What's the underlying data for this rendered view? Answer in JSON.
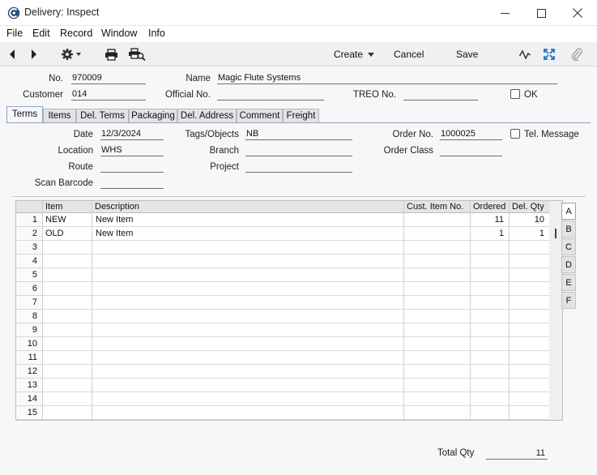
{
  "window": {
    "title": "Delivery: Inspect"
  },
  "menu": [
    "File",
    "Edit",
    "Record",
    "Window",
    "Info"
  ],
  "toolbar": {
    "create": "Create",
    "cancel": "Cancel",
    "save": "Save"
  },
  "header": {
    "no_label": "No.",
    "no": "970009",
    "name_label": "Name",
    "name": "Magic Flute Systems",
    "customer_label": "Customer",
    "customer": "014",
    "official_label": "Official No.",
    "official": "",
    "treo_label": "TREO No.",
    "treo": "",
    "ok_label": "OK"
  },
  "tabs": [
    "Terms",
    "Items",
    "Del. Terms",
    "Packaging",
    "Del. Address",
    "Comment",
    "Freight"
  ],
  "terms": {
    "date_label": "Date",
    "date": "12/3/2024",
    "location_label": "Location",
    "location": "WHS",
    "route_label": "Route",
    "route": "",
    "scan_label": "Scan Barcode",
    "scan": "",
    "tags_label": "Tags/Objects",
    "tags": "NB",
    "branch_label": "Branch",
    "branch": "",
    "project_label": "Project",
    "project": "",
    "order_no_label": "Order No.",
    "order_no": "1000025",
    "order_class_label": "Order Class",
    "order_class": "",
    "tel_label": "Tel. Message"
  },
  "grid": {
    "columns": [
      "Item",
      "Description",
      "Cust. Item No.",
      "Ordered",
      "Del. Qty"
    ],
    "rows": [
      {
        "n": "1",
        "item": "NEW",
        "desc": "New Item",
        "cust": "",
        "ordered": "11",
        "delqty": "10"
      },
      {
        "n": "2",
        "item": "OLD",
        "desc": "New Item",
        "cust": "",
        "ordered": "1",
        "delqty": "1"
      },
      {
        "n": "3",
        "item": "",
        "desc": "",
        "cust": "",
        "ordered": "",
        "delqty": ""
      },
      {
        "n": "4",
        "item": "",
        "desc": "",
        "cust": "",
        "ordered": "",
        "delqty": ""
      },
      {
        "n": "5",
        "item": "",
        "desc": "",
        "cust": "",
        "ordered": "",
        "delqty": ""
      },
      {
        "n": "6",
        "item": "",
        "desc": "",
        "cust": "",
        "ordered": "",
        "delqty": ""
      },
      {
        "n": "7",
        "item": "",
        "desc": "",
        "cust": "",
        "ordered": "",
        "delqty": ""
      },
      {
        "n": "8",
        "item": "",
        "desc": "",
        "cust": "",
        "ordered": "",
        "delqty": ""
      },
      {
        "n": "9",
        "item": "",
        "desc": "",
        "cust": "",
        "ordered": "",
        "delqty": ""
      },
      {
        "n": "10",
        "item": "",
        "desc": "",
        "cust": "",
        "ordered": "",
        "delqty": ""
      },
      {
        "n": "11",
        "item": "",
        "desc": "",
        "cust": "",
        "ordered": "",
        "delqty": ""
      },
      {
        "n": "12",
        "item": "",
        "desc": "",
        "cust": "",
        "ordered": "",
        "delqty": ""
      },
      {
        "n": "13",
        "item": "",
        "desc": "",
        "cust": "",
        "ordered": "",
        "delqty": ""
      },
      {
        "n": "14",
        "item": "",
        "desc": "",
        "cust": "",
        "ordered": "",
        "delqty": ""
      },
      {
        "n": "15",
        "item": "",
        "desc": "",
        "cust": "",
        "ordered": "",
        "delqty": ""
      }
    ]
  },
  "side_tabs": [
    "A",
    "B",
    "C",
    "D",
    "E",
    "F"
  ],
  "footer": {
    "total_qty_label": "Total Qty",
    "total_qty": "11"
  },
  "colors": {
    "tab_accent": "#8aa4c6",
    "form_bg": "#f7f7f7",
    "toolbar_bg": "#f0f0f0"
  }
}
